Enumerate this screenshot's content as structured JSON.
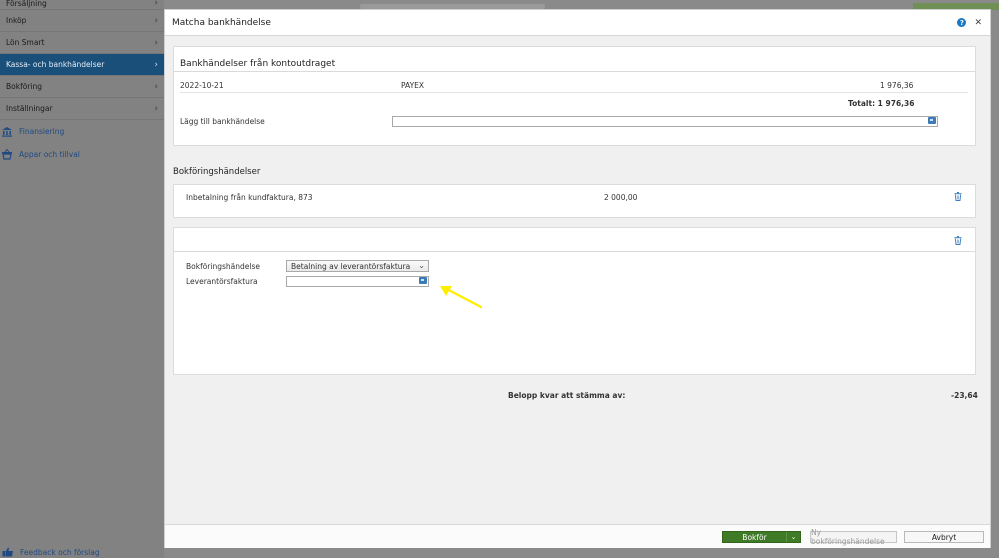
{
  "sidebar": {
    "items": [
      {
        "label": "Försäljning"
      },
      {
        "label": "Inköp"
      },
      {
        "label": "Lön Smart"
      },
      {
        "label": "Kassa- och bankhändelser"
      },
      {
        "label": "Bokföring"
      },
      {
        "label": "Inställningar"
      }
    ],
    "links": [
      {
        "label": "Finansiering",
        "icon": "bank-icon"
      },
      {
        "label": "Appar och tillval",
        "icon": "basket-icon"
      }
    ],
    "feedback": "Feedback och förslag"
  },
  "modal": {
    "title": "Matcha bankhändelse",
    "bank_panel": {
      "title": "Bankhändelser från kontoutdraget",
      "row": {
        "date": "2022-10-21",
        "payee": "PAYEX",
        "amount": "1 976,36"
      },
      "total": "Totalt: 1 976,36",
      "add_label": "Lägg till bankhändelse",
      "add_value": ""
    },
    "section_title": "Bokföringshändelser",
    "event1": {
      "description": "Inbetalning från kundfaktura, 873",
      "amount": "2 000,00"
    },
    "event2": {
      "type_label": "Bokföringshändelse",
      "type_value": "Betalning av leverantörsfaktura",
      "invoice_label": "Leverantörsfaktura",
      "invoice_value": ""
    },
    "remaining_label": "Belopp kvar att stämma av:",
    "remaining_value": "-23,64",
    "buttons": {
      "bokfor": "Bokför",
      "new_event": "Ny bokföringshändelse",
      "cancel": "Avbryt"
    }
  },
  "colors": {
    "active_nav": "#1a4f7a",
    "primary_button": "#3f7a26",
    "annotation_arrow": "#ffee00",
    "link": "#1f4a82"
  }
}
